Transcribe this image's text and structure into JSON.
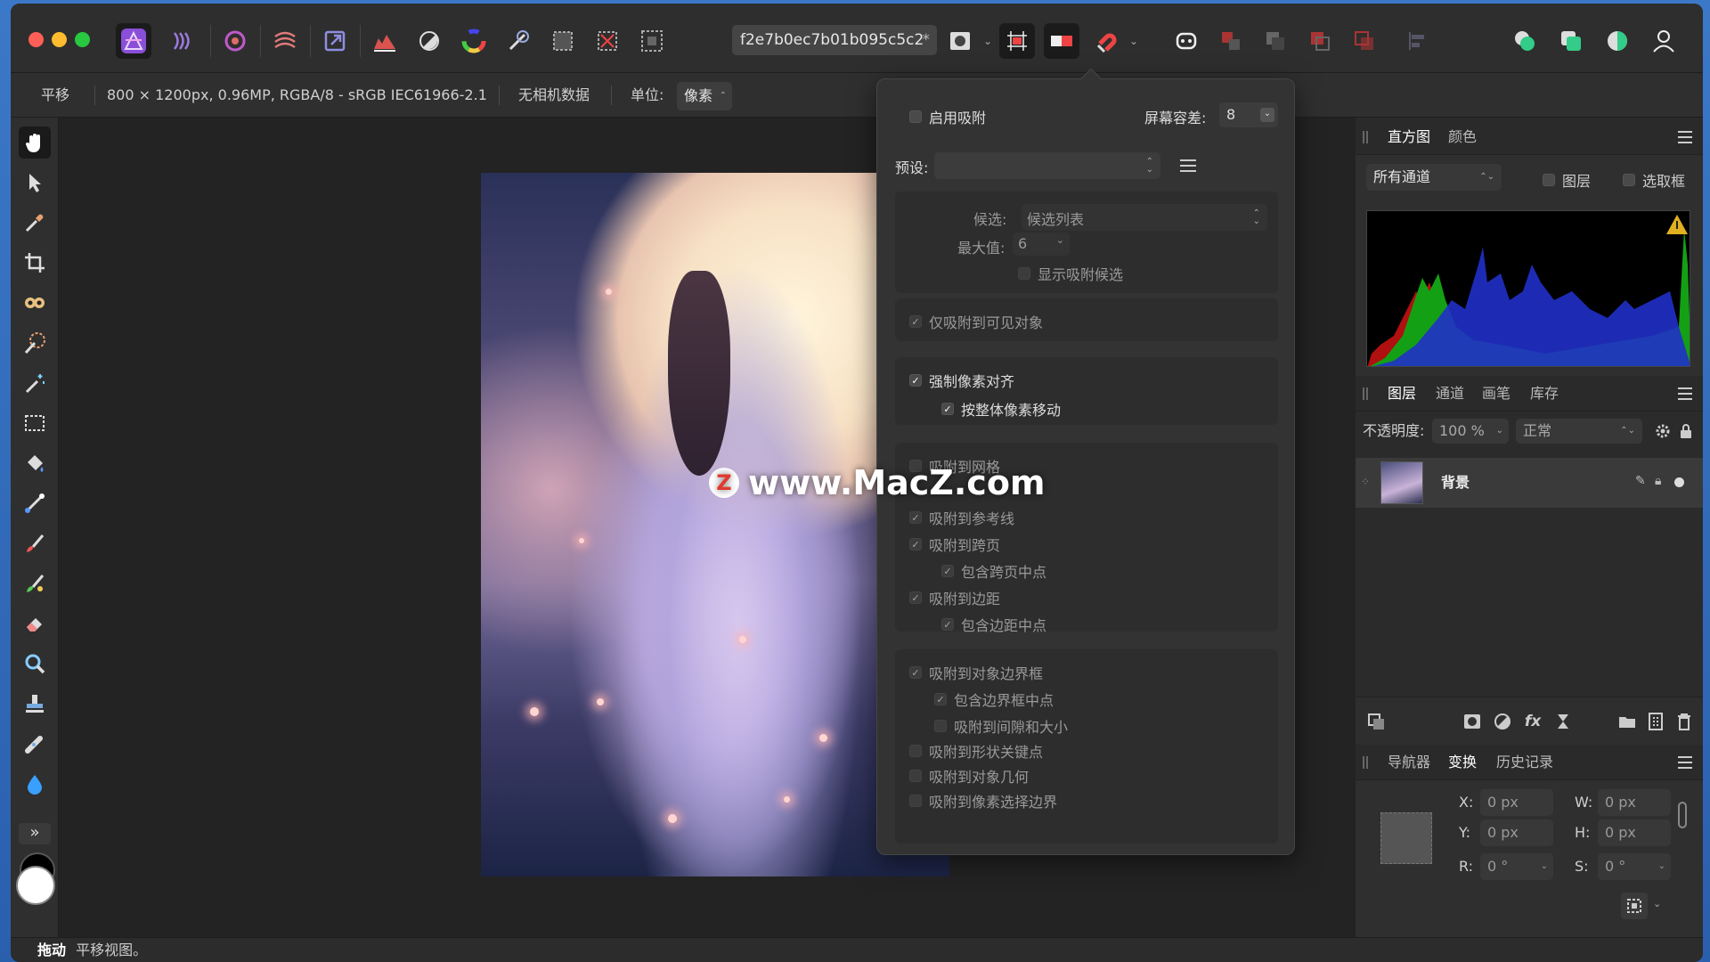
{
  "toolbar": {
    "document_tab": "f2e7b0ec7b01b095c5c2",
    "document_modified": "*"
  },
  "context": {
    "tool_name": "平移",
    "doc_info": "800 × 1200px, 0.96MP, RGBA/8 - sRGB IEC61966-2.1",
    "camera": "无相机数据",
    "unit_label": "单位:",
    "unit_value": "像素"
  },
  "snapping": {
    "enable": "启用吸附",
    "tolerance_label": "屏幕容差:",
    "tolerance_value": "8",
    "preset_label": "预设:",
    "candidate_label": "候选:",
    "candidate_value": "候选列表",
    "max_label": "最大值:",
    "max_value": "6",
    "show_candidates": "显示吸附候选",
    "visible_only": "仅吸附到可见对象",
    "force_pixel": "强制像素对齐",
    "whole_pixel": "按整体像素移动",
    "grid": "吸附到网格",
    "guides": "吸附到参考线",
    "spreads": "吸附到跨页",
    "spread_mid": "包含跨页中点",
    "margins": "吸附到边距",
    "margin_mid": "包含边距中点",
    "bbox": "吸附到对象边界框",
    "bbox_mid": "包含边界框中点",
    "gaps": "吸附到间隙和大小",
    "shape_keys": "吸附到形状关键点",
    "geometry": "吸附到对象几何",
    "pixel_sel": "吸附到像素选择边界"
  },
  "histogram_panel": {
    "tab_histogram": "直方图",
    "tab_color": "颜色",
    "channel": "所有通道",
    "layer_cb": "图层",
    "marquee_cb": "选取框"
  },
  "layers_panel": {
    "tab_layers": "图层",
    "tab_channels": "通道",
    "tab_brushes": "画笔",
    "tab_stock": "库存",
    "opacity_label": "不透明度:",
    "opacity_value": "100 %",
    "blend": "正常",
    "layer_name": "背景"
  },
  "transform_panel": {
    "tab_navigator": "导航器",
    "tab_transform": "变换",
    "tab_history": "历史记录",
    "x_label": "X:",
    "x_value": "0 px",
    "y_label": "Y:",
    "y_value": "0 px",
    "w_label": "W:",
    "w_value": "0 px",
    "h_label": "H:",
    "h_value": "0 px",
    "r_label": "R:",
    "r_value": "0 °",
    "s_label": "S:",
    "s_value": "0 °"
  },
  "status": {
    "action": "拖动",
    "hint": "平移视图。"
  },
  "watermark": {
    "badge": "Z",
    "text": "www.MacZ.com"
  },
  "colors": {
    "accent": "#7b4fd6",
    "window_bg": "#2b2b2b"
  }
}
